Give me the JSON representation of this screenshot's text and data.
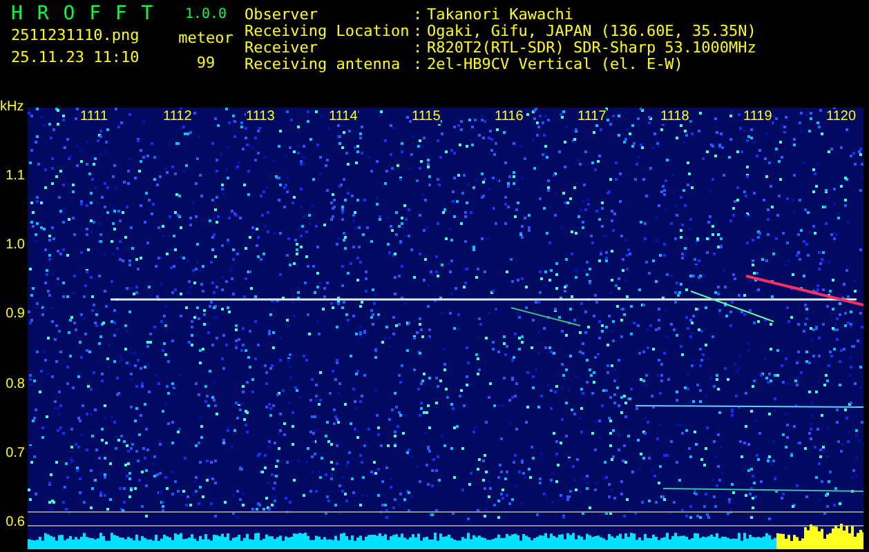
{
  "app": {
    "title": "H R O F F T",
    "version": "1.0.0"
  },
  "image": {
    "filename": "2511231110.png",
    "datetime": "25.11.23 11:10"
  },
  "meteor": {
    "label": "meteor",
    "count": "99"
  },
  "info": [
    {
      "label": "Observer",
      "separator": ":",
      "value": "Takanori Kawachi"
    },
    {
      "label": "Receiving Location",
      "separator": ":",
      "value": "Ogaki, Gifu, JAPAN (136.60E, 35.35N)"
    },
    {
      "label": "Receiver",
      "separator": ":",
      "value": "R820T2(RTL-SDR) SDR-Sharp 53.1000MHz"
    },
    {
      "label": "Receiving antenna",
      "separator": ":",
      "value": "2el-HB9CV Vertical (el. E-W)"
    }
  ],
  "y_axis": {
    "unit": "kHz",
    "labels": [
      "1.1",
      "1.0",
      "0.9",
      "0.8",
      "0.7",
      "0.6"
    ]
  },
  "x_axis": {
    "labels": [
      "1111",
      "1112",
      "1113",
      "1114",
      "1115",
      "1116",
      "1117",
      "1118",
      "1119",
      "1120"
    ]
  }
}
